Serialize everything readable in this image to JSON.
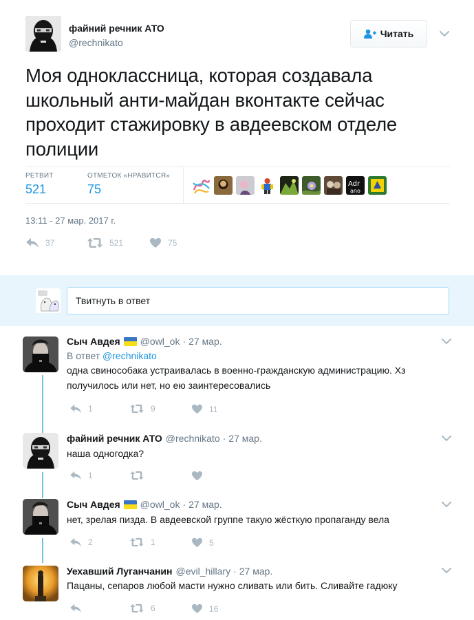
{
  "main_tweet": {
    "author_name": "файний речник АТО",
    "author_handle": "@rechnikato",
    "follow_label": "Читать",
    "text": "Моя одноклассница, которая создавала школьный анти-майдан вконтакте сейчас проходит стажировку в авдеевском отделе полиции",
    "retweets_label": "РЕТВИТ",
    "retweets_count": "521",
    "likes_label": "ОТМЕТОК «НРАВИТСЯ»",
    "likes_count": "75",
    "timestamp": "13:11 - 27 мар. 2017 г.",
    "actions": {
      "replies": "37",
      "retweets": "521",
      "likes": "75"
    }
  },
  "reply_box": {
    "placeholder": "Твитнуть в ответ"
  },
  "replies": [
    {
      "name": "Сыч Авдея",
      "has_flag": true,
      "handle": "@owl_ok",
      "time": "27 мар.",
      "reply_to_label": "В ответ",
      "reply_to_handle": "@rechnikato",
      "text": "одна свинособака устраивалась в военно-гражданскую администрацию. Хз получилось или нет, но ею заинтересовались",
      "counts": {
        "replies": "1",
        "retweets": "9",
        "likes": "11"
      }
    },
    {
      "name": "файний речник АТО",
      "has_flag": false,
      "handle": "@rechnikato",
      "time": "27 мар.",
      "text": "наша одногодка?",
      "counts": {
        "replies": "1",
        "retweets": "",
        "likes": ""
      }
    },
    {
      "name": "Сыч Авдея",
      "has_flag": true,
      "handle": "@owl_ok",
      "time": "27 мар.",
      "text": "нет, зрелая пизда. В авдеевской группе такую жёсткую пропаганду вела",
      "counts": {
        "replies": "2",
        "retweets": "1",
        "likes": "5"
      }
    },
    {
      "name": "Уехавший Луганчанин",
      "has_flag": false,
      "handle": "@evil_hillary",
      "time": "27 мар.",
      "text": "Пацаны, сепаров любой масти нужно сливать или бить. Сливайте гадюку",
      "counts": {
        "replies": "",
        "retweets": "6",
        "likes": "16"
      }
    }
  ],
  "colors": {
    "accent": "#1b95e0",
    "muted": "#657786",
    "icon": "#aab8c2",
    "reply_bg": "#e8f5fd",
    "thread_line": "#75c0dc",
    "flag_blue": "#3a75c4",
    "flag_yellow": "#f9dd16"
  }
}
